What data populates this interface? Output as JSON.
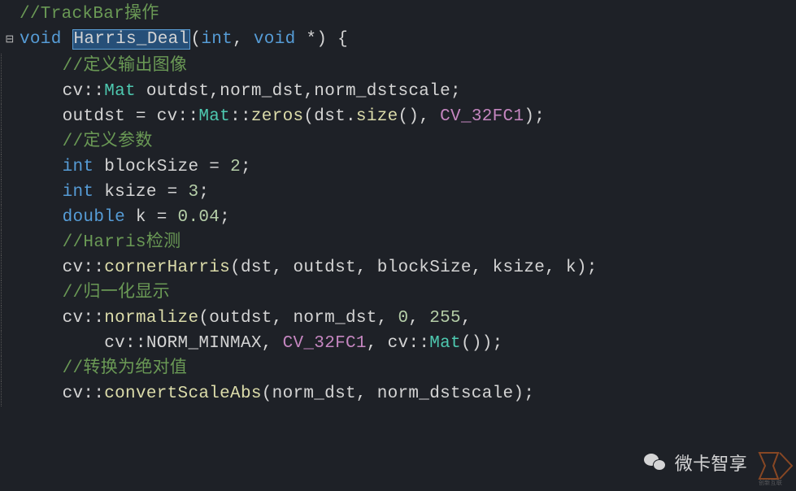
{
  "code": {
    "line1_comment": "//TrackBar操作",
    "line2_void": "void",
    "line2_funcname": "Harris_Deal",
    "line2_int": "int",
    "line2_voidptr": "void",
    "line2_asterisk": " *",
    "line2_brace": " {",
    "line3_comment": "//定义输出图像",
    "line4_cv": "cv",
    "line4_dblcolon1": "::",
    "line4_mat": "Mat",
    "line4_vars": " outdst,norm_dst,norm_dstscale;",
    "line5_outdst": "outdst = ",
    "line5_cv": "cv",
    "line5_dblcolon1": "::",
    "line5_mat": "Mat",
    "line5_dblcolon2": "::",
    "line5_zeros": "zeros",
    "line5_args_open": "(dst.",
    "line5_size": "size",
    "line5_args_mid": "(), ",
    "line5_cv32fc1": "CV_32FC1",
    "line5_args_close": ");",
    "line6_comment": "//定义参数",
    "line7_int": "int",
    "line7_rest": " blockSize = ",
    "line7_val": "2",
    "line7_semi": ";",
    "line8_int": "int",
    "line8_rest": " ksize = ",
    "line8_val": "3",
    "line8_semi": ";",
    "line9_double": "double",
    "line9_rest": " k = ",
    "line9_val": "0.04",
    "line9_semi": ";",
    "line10_comment": "//Harris检测",
    "line11_cv": "cv",
    "line11_dblcolon": "::",
    "line11_func": "cornerHarris",
    "line11_args": "(dst, outdst, blockSize, ksize, k);",
    "line12_comment": "//归一化显示",
    "line13_cv": "cv",
    "line13_dblcolon": "::",
    "line13_func": "normalize",
    "line13_args_open": "(outdst, norm_dst, ",
    "line13_zero": "0",
    "line13_comma1": ", ",
    "line13_255": "255",
    "line13_comma2": ",",
    "line14_cv1": "cv",
    "line14_dblcolon1": "::",
    "line14_normminmax": "NORM_MINMAX",
    "line14_comma1": ", ",
    "line14_cv32fc1": "CV_32FC1",
    "line14_comma2": ", ",
    "line14_cv2": "cv",
    "line14_dblcolon2": "::",
    "line14_mat": "Mat",
    "line14_close": "());",
    "line15_comment": "//转换为绝对值",
    "line16_cv": "cv",
    "line16_dblcolon": "::",
    "line16_func": "convertScaleAbs",
    "line16_args": "(norm_dst, norm_dstscale);"
  },
  "watermark": {
    "label": "微卡智享"
  },
  "icons": {
    "fold": "⊟",
    "wechat": "wechat-icon"
  }
}
